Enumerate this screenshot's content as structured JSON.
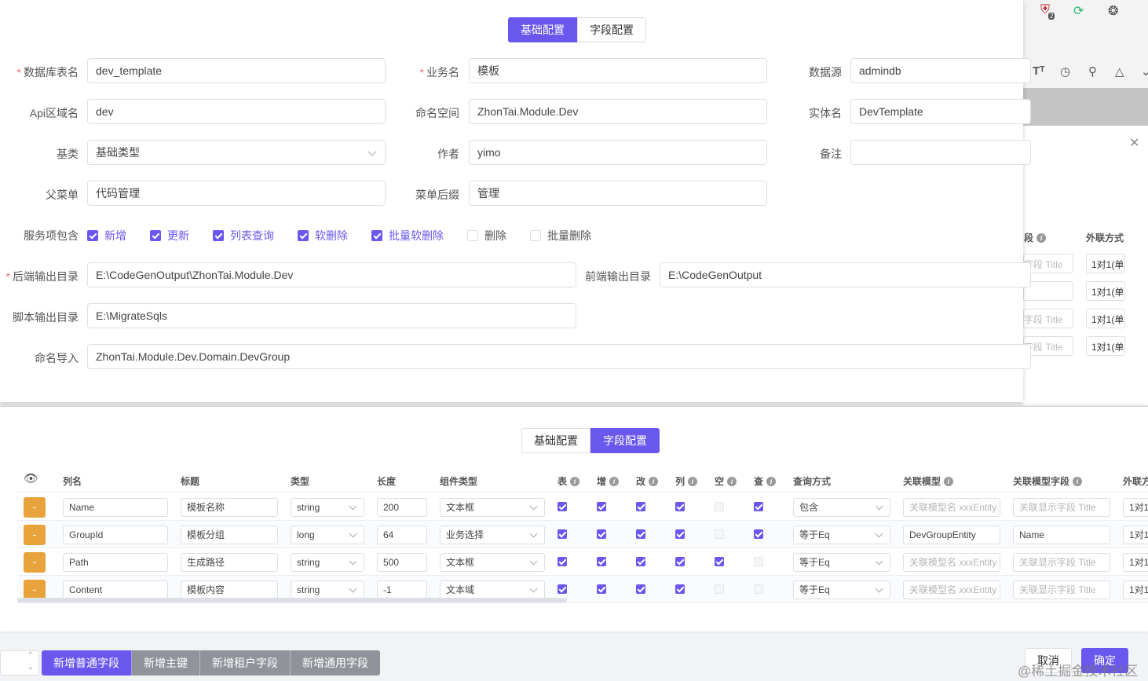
{
  "browser": {
    "ext_badge": "2",
    "icons": [
      "shield-badge-icon",
      "refresh-icon",
      "puzzle-icon"
    ],
    "toolbar_icons": [
      "font-size-icon",
      "globe-icon",
      "search-icon",
      "shirt-icon",
      "chevron-down-icon"
    ]
  },
  "back_panel": {
    "header_field": "段",
    "header_join": "外联方式",
    "rows": [
      {
        "field": "字段 Title",
        "join": "1对1(单"
      },
      {
        "field": "",
        "join": "1对1(单"
      },
      {
        "field": "字段 Title",
        "join": "1对1(单"
      },
      {
        "field": "字段 Title",
        "join": "1对1(单"
      }
    ]
  },
  "top_tabs": [
    "基础配置",
    "字段配置"
  ],
  "form": {
    "table_name_label": "数据库表名",
    "table_name": "dev_template",
    "business_label": "业务名",
    "business": "模板",
    "datasource_label": "数据源",
    "datasource": "admindb",
    "api_area_label": "Api区域名",
    "api_area": "dev",
    "namespace_label": "命名空间",
    "namespace": "ZhonTai.Module.Dev",
    "entity_label": "实体名",
    "entity": "DevTemplate",
    "base_label": "基类",
    "base": "基础类型",
    "author_label": "作者",
    "author": "yimo",
    "remark_label": "备注",
    "remark": "",
    "parent_menu_label": "父菜单",
    "parent_menu": "代码管理",
    "menu_suffix_label": "菜单后缀",
    "menu_suffix": "管理",
    "services_label": "服务项包含",
    "services": [
      {
        "label": "新增",
        "checked": true
      },
      {
        "label": "更新",
        "checked": true
      },
      {
        "label": "列表查询",
        "checked": true
      },
      {
        "label": "软删除",
        "checked": true
      },
      {
        "label": "批量软删除",
        "checked": true
      },
      {
        "label": "删除",
        "checked": false
      },
      {
        "label": "批量删除",
        "checked": false
      }
    ],
    "backend_dir_label": "后端输出目录",
    "backend_dir": "E:\\CodeGenOutput\\ZhonTai.Module.Dev",
    "frontend_dir_label": "前端输出目录",
    "frontend_dir": "E:\\CodeGenOutput",
    "script_dir_label": "脚本输出目录",
    "script_dir": "E:\\MigrateSqls",
    "imports_label": "命名导入",
    "imports": "ZhonTai.Module.Dev.Domain.DevGroup"
  },
  "bottom_tabs": [
    "基础配置",
    "字段配置"
  ],
  "table": {
    "headers": {
      "column": "列名",
      "title": "标题",
      "type": "类型",
      "length": "长度",
      "component": "组件类型",
      "t": "表",
      "add": "增",
      "edit": "改",
      "list": "列",
      "empty": "空",
      "query": "查",
      "query_mode": "查询方式",
      "rel_model": "关联模型",
      "rel_field": "关联模型字段",
      "join": "外联方"
    },
    "rows": [
      {
        "minus": "-",
        "column": "Name",
        "title": "模板名称",
        "type": "string",
        "length": "200",
        "component": "文本框",
        "t": true,
        "add": true,
        "edit": true,
        "list": true,
        "empty": false,
        "query": true,
        "query_mode": "包含",
        "rel_model": "关联模型名 xxxEntity",
        "rel_model_ph": true,
        "rel_field": "关联显示字段 Title",
        "rel_field_ph": true,
        "join": "1对1"
      },
      {
        "minus": "-",
        "column": "GroupId",
        "title": "模板分组",
        "type": "long",
        "length": "64",
        "component": "业务选择",
        "t": true,
        "add": true,
        "edit": true,
        "list": true,
        "empty": false,
        "query": true,
        "query_mode": "等于Eq",
        "rel_model": "DevGroupEntity",
        "rel_model_ph": false,
        "rel_field": "Name",
        "rel_field_ph": false,
        "join": "1对1"
      },
      {
        "minus": "-",
        "column": "Path",
        "title": "生成路径",
        "type": "string",
        "length": "500",
        "component": "文本框",
        "t": true,
        "add": true,
        "edit": true,
        "list": true,
        "empty": true,
        "query": false,
        "query_mode": "等于Eq",
        "rel_model": "关联模型名 xxxEntity",
        "rel_model_ph": true,
        "rel_field": "关联显示字段 Title",
        "rel_field_ph": true,
        "join": "1对1"
      },
      {
        "minus": "-",
        "column": "Content",
        "title": "模板内容",
        "type": "string",
        "length": "-1",
        "component": "文本域",
        "t": true,
        "add": true,
        "edit": true,
        "list": true,
        "empty": false,
        "query": false,
        "query_mode": "等于Eq",
        "rel_model": "关联模型名 xxxEntity",
        "rel_model_ph": true,
        "rel_field": "关联显示字段 Title",
        "rel_field_ph": true,
        "join": "1对1"
      }
    ]
  },
  "footer": {
    "add_buttons": [
      "新增普通字段",
      "新增主键",
      "新增租户字段",
      "新增通用字段"
    ],
    "cancel": "取消",
    "confirm": "确定",
    "watermark": "@稀土掘金技术社区"
  },
  "colors": {
    "accent": "#6a57ee",
    "minus": "#e8a33d",
    "required": "#f56c6c"
  }
}
